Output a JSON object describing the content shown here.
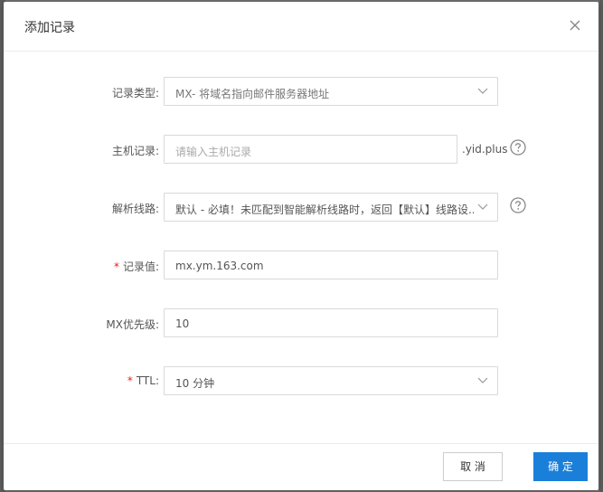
{
  "dialog": {
    "title": "添加记录"
  },
  "form": {
    "record_type": {
      "label": "记录类型:",
      "value": "MX- 将域名指向邮件服务器地址"
    },
    "host_record": {
      "label": "主机记录:",
      "placeholder": "请输入主机记录",
      "suffix": ".yid.plus"
    },
    "line": {
      "label": "解析线路:",
      "value": "默认 - 必填！未匹配到智能解析线路时，返回【默认】线路设..."
    },
    "record_value": {
      "required_mark": "*",
      "label": "记录值:",
      "value": "mx.ym.163.com"
    },
    "mx_priority": {
      "label": "MX优先级:",
      "value": "10"
    },
    "ttl": {
      "required_mark": "*",
      "label": "TTL:",
      "value": "10 分钟"
    }
  },
  "footer": {
    "cancel_label": "取 消",
    "ok_label": "确 定"
  },
  "colors": {
    "primary": "#1a7fd9",
    "required": "#e2231a"
  },
  "icons": {
    "close": "close-icon",
    "chevron": "chevron-down-icon",
    "help": "help-icon"
  }
}
